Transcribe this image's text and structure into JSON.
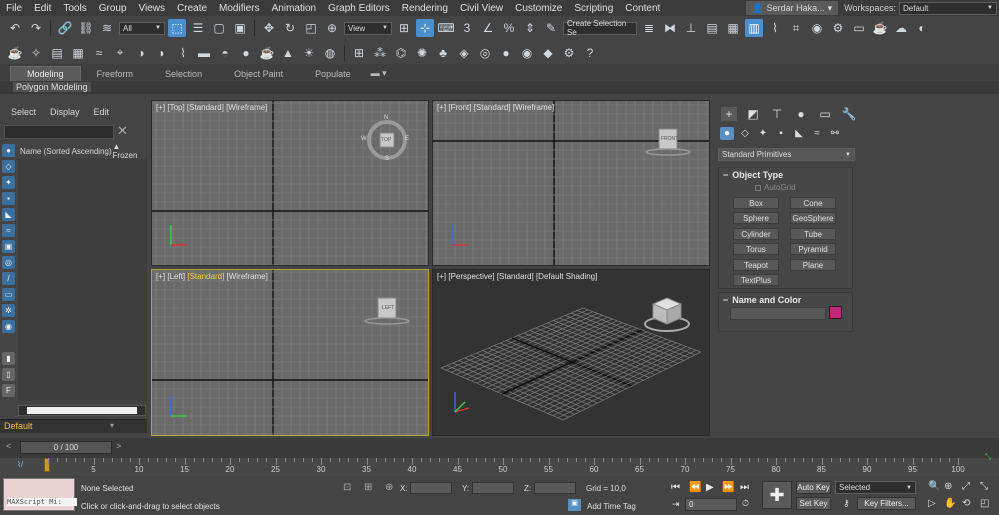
{
  "menubar": {
    "items": [
      "File",
      "Edit",
      "Tools",
      "Group",
      "Views",
      "Create",
      "Modifiers",
      "Animation",
      "Graph Editors",
      "Rendering",
      "Civil View",
      "Customize",
      "Scripting",
      "Content"
    ],
    "user": "Serdar Haka...",
    "workspaces_label": "Workspaces:",
    "workspace_value": "Default"
  },
  "toolbar1": {
    "selection_filter": "All",
    "ref_coord": "View",
    "selection_set": "Create Selection Se"
  },
  "ribbon": {
    "tabs": [
      "Modeling",
      "Freeform",
      "Selection",
      "Object Paint",
      "Populate"
    ],
    "active_tab": "Modeling",
    "sub_label": "Polygon Modeling"
  },
  "scene_explorer": {
    "menu": [
      "Select",
      "Display",
      "Edit"
    ],
    "column_name": "Name (Sorted Ascending)",
    "column_frozen": "▲ Frozen",
    "layer": "Default"
  },
  "viewports": {
    "top": {
      "p1": "[+]",
      "p2": " [Top] ",
      "p3": "[Standard]",
      "p4": " [Wireframe]",
      "cube": "TOP",
      "compass": [
        "N",
        "E",
        "S",
        "W"
      ]
    },
    "front": {
      "p1": "[+]",
      "p2": " [Front] ",
      "p3": "[Standard]",
      "p4": " [Wireframe]",
      "cube": "FRONT"
    },
    "left": {
      "p1": "[+]",
      "p2": " [Left] ",
      "p3": "[Standard]",
      "p4": " [Wireframe]",
      "cube": "LEFT"
    },
    "perspective": {
      "p1": "[+]",
      "p2": " [Perspective] ",
      "p3": "[Standard]",
      "p4": " [Default Shading]"
    }
  },
  "command_panel": {
    "category": "Standard Primitives",
    "object_type_title": "Object Type",
    "autogrid": "AutoGrid",
    "buttons": [
      "Box",
      "Cone",
      "Sphere",
      "GeoSphere",
      "Cylinder",
      "Tube",
      "Torus",
      "Pyramid",
      "Teapot",
      "Plane",
      "TextPlus"
    ],
    "name_color_title": "Name and Color",
    "object_color": "#c0267a"
  },
  "timeline": {
    "slider_label": "0 / 100",
    "ticks": [
      "0",
      "5",
      "10",
      "15",
      "20",
      "25",
      "30",
      "35",
      "40",
      "45",
      "50",
      "55",
      "60",
      "65",
      "70",
      "75",
      "80",
      "85",
      "90",
      "95",
      "100"
    ]
  },
  "statusbar": {
    "maxscript": "MAXScript Mi:",
    "selection": "None Selected",
    "prompt": "Click or click-and-drag to select objects",
    "x_label": "X:",
    "y_label": "Y:",
    "z_label": "Z:",
    "grid": "Grid = 10,0",
    "add_time_tag": "Add Time Tag",
    "auto_key": "Auto Key",
    "set_key": "Set Key",
    "key_mode": "Selected",
    "key_filters": "Key Filters...",
    "frame": "0"
  }
}
